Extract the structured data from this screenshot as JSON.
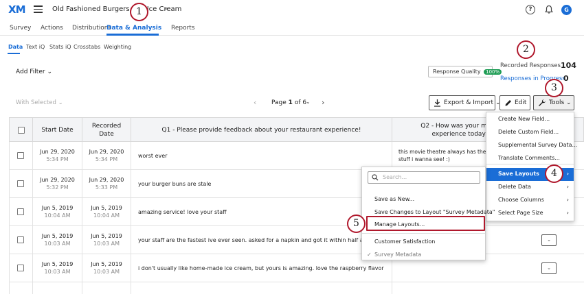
{
  "topbar": {
    "logo": "XM",
    "survey_title": "Old Fashioned Burgers and Ice Cream",
    "avatar_initial": "G"
  },
  "main_nav": {
    "tabs": [
      "Survey",
      "Actions",
      "Distributions",
      "Data & Analysis",
      "Reports"
    ],
    "active": "Data & Analysis"
  },
  "sub_nav": {
    "tabs": [
      "Data",
      "Text iQ",
      "Stats iQ",
      "Crosstabs",
      "Weighting"
    ],
    "active": "Data"
  },
  "filters": {
    "add_filter": "Add Filter",
    "response_quality_label": "Response Quality",
    "response_quality_badge": "100%"
  },
  "stats": {
    "recorded_label": "Recorded Responses",
    "recorded_value": "104",
    "in_progress_label": "Responses in Progress",
    "in_progress_value": "0"
  },
  "toolbar": {
    "with_selected": "With Selected",
    "page_prefix": "Page",
    "page_current": "1",
    "page_of": "of 6",
    "export_label": "Export & Import",
    "edit_label": "Edit",
    "tools_label": "Tools"
  },
  "table": {
    "headers": [
      "Start Date",
      "Recorded Date",
      "Q1 - Please provide feedback about your restaurant experience!",
      "Q2 - How was your movie experience today?"
    ],
    "rows": [
      {
        "start_date": "Jun 29, 2020",
        "start_time": "5:34 PM",
        "recorded_date": "Jun 29, 2020",
        "recorded_time": "5:34 PM",
        "q1": "worst ever",
        "q2_line1": "this movie theatre always has the obscure",
        "q2_line2": "stuff i wanna see! :)"
      },
      {
        "start_date": "Jun 29, 2020",
        "start_time": "5:32 PM",
        "recorded_date": "Jun 29, 2020",
        "recorded_time": "5:33 PM",
        "q1": "your burger buns are stale",
        "q2_line1": "",
        "q2_line2": ""
      },
      {
        "start_date": "Jun 5, 2019",
        "start_time": "10:04 AM",
        "recorded_date": "Jun 5, 2019",
        "recorded_time": "10:04 AM",
        "q1": "amazing service! love your staff",
        "q2_line1": "",
        "q2_line2": ""
      },
      {
        "start_date": "Jun 5, 2019",
        "start_time": "10:03 AM",
        "recorded_date": "Jun 5, 2019",
        "recorded_time": "10:03 AM",
        "q1": "your staff are the fastest ive ever seen. asked for a napkin and got it within half a second, great service",
        "q2_line1": "",
        "q2_line2": ""
      },
      {
        "start_date": "Jun 5, 2019",
        "start_time": "10:03 AM",
        "recorded_date": "Jun 5, 2019",
        "recorded_time": "10:03 AM",
        "q1": "i don't usually like home-made ice cream, but yours is amazing. love the raspberry flavor",
        "q2_line1": "",
        "q2_line2": ""
      }
    ]
  },
  "tools_menu": {
    "items": [
      "Create New Field...",
      "Delete Custom Field...",
      "Supplemental Survey Data...",
      "Translate Comments...",
      "Save Layouts",
      "Delete Data",
      "Choose Columns",
      "Select Page Size"
    ],
    "highlighted": "Save Layouts"
  },
  "layouts_menu": {
    "search_placeholder": "Search...",
    "save_as_new": "Save as New...",
    "save_changes": "Save Changes to Layout \"Survey Metadata\"",
    "manage": "Manage Layouts...",
    "layouts": [
      "Customer Satisfaction",
      "Survey Metadata"
    ],
    "selected_layout": "Survey Metadata"
  },
  "callouts": [
    "1",
    "2",
    "3",
    "4",
    "5"
  ],
  "colors": {
    "accent": "#1a6dd6",
    "callout_border": "#b0182c",
    "quality_badge": "#1f9d55"
  }
}
